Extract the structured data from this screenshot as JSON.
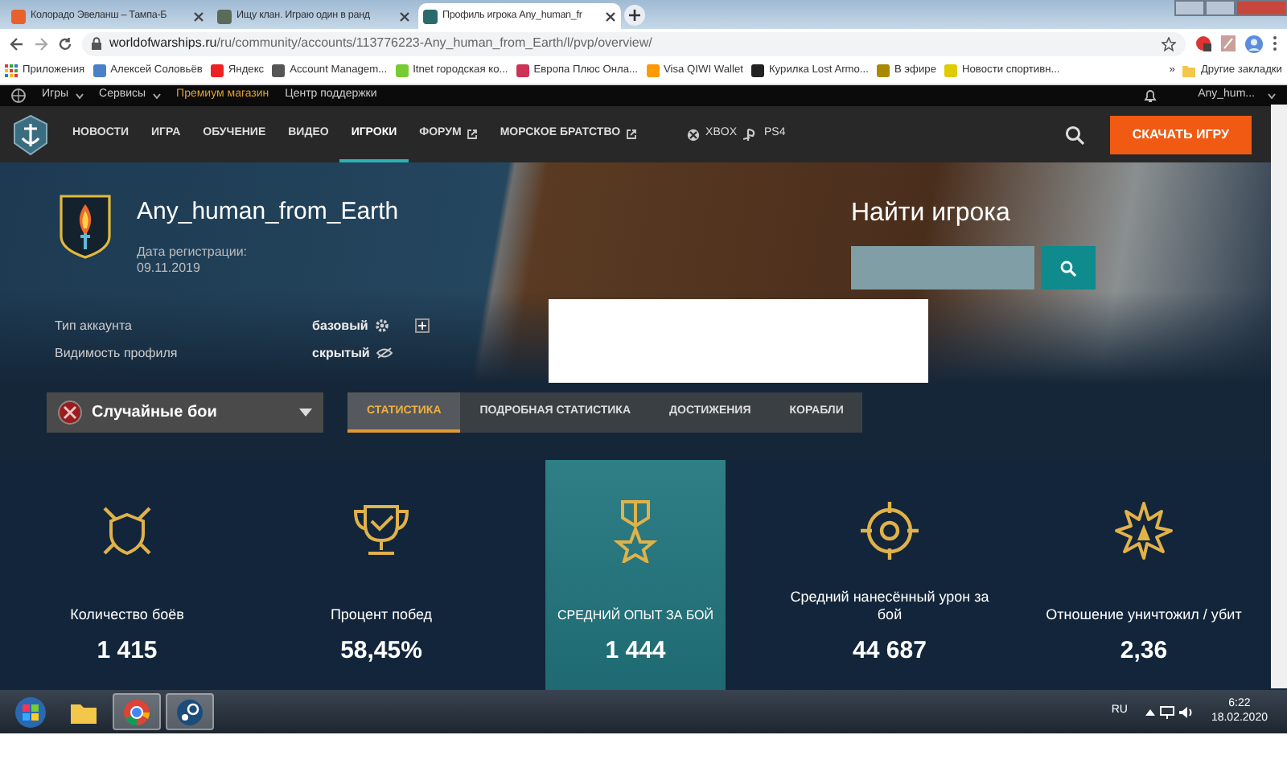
{
  "browser": {
    "tabs": [
      {
        "title": "Колорадо Эвеланш – Тампа-Б",
        "selected": false
      },
      {
        "title": "Ищу клан. Играю один в ранд",
        "selected": false
      },
      {
        "title": "Профиль игрока Any_human_fr",
        "selected": true
      }
    ],
    "address": "**worldofwarships.ru**/ru/community/accounts/113776223-Any_human_from_Earth/l/pvp/overview/",
    "bookmarks": [
      {
        "label": "Приложения"
      },
      {
        "label": "Алексей Соловьёв"
      },
      {
        "label": "Яндекс"
      },
      {
        "label": "Account Managem..."
      },
      {
        "label": "Itnet городская ко..."
      },
      {
        "label": "Европа Плюс Онла..."
      },
      {
        "label": "Visa QIWI Wallet"
      },
      {
        "label": "Курилка Lost Armo..."
      },
      {
        "label": "В эфире"
      },
      {
        "label": "Новости спортивн..."
      }
    ],
    "more": "»",
    "other_bookmarks": "Другие закладки"
  },
  "topbar": {
    "items": [
      {
        "label": "Игры",
        "dropdown": true,
        "highlight": false
      },
      {
        "label": "Сервисы",
        "dropdown": true,
        "highlight": false
      },
      {
        "label": "Премиум магазин",
        "dropdown": false,
        "highlight": true
      },
      {
        "label": "Центр поддержки",
        "dropdown": false,
        "highlight": false
      }
    ],
    "user": "Any_hum..."
  },
  "nav": {
    "items": [
      {
        "label": "НОВОСТИ",
        "selected": false,
        "external": false
      },
      {
        "label": "ИГРА",
        "selected": false,
        "external": false
      },
      {
        "label": "ОБУЧЕНИЕ",
        "selected": false,
        "external": false
      },
      {
        "label": "ВИДЕО",
        "selected": false,
        "external": false
      },
      {
        "label": "ИГРОКИ",
        "selected": true,
        "external": false
      },
      {
        "label": "ФОРУМ",
        "selected": false,
        "external": true
      },
      {
        "label": "МОРСКОЕ БРАТСТВО",
        "selected": false,
        "external": true
      }
    ],
    "platforms": [
      "XBOX",
      "PS4"
    ],
    "download": "СКАЧАТЬ ИГРУ"
  },
  "profile": {
    "name": "Any_human_from_Earth",
    "reg_label": "Дата регистрации:",
    "reg_date": "09.11.2019",
    "find_title": "Найти игрока",
    "rows": [
      {
        "label": "Тип аккаунта",
        "value": "базовый",
        "kind": "account"
      },
      {
        "label": "Видимость профиля",
        "value": "скрытый",
        "kind": "visibility"
      }
    ],
    "mode": "Случайные бои",
    "tabs": [
      {
        "label": "СТАТИСТИКА",
        "selected": true
      },
      {
        "label": "ПОДРОБНАЯ СТАТИСТИКА",
        "selected": false
      },
      {
        "label": "ДОСТИЖЕНИЯ",
        "selected": false
      },
      {
        "label": "КОРАБЛИ",
        "selected": false
      }
    ],
    "stats": [
      {
        "kind": "battles",
        "label": "Количество боёв",
        "value": "1 415",
        "selected": false
      },
      {
        "kind": "wins",
        "label": "Процент побед",
        "value": "58,45%",
        "selected": false
      },
      {
        "kind": "xp",
        "label": "СРЕДНИЙ ОПЫТ ЗА БОЙ",
        "value": "1 444",
        "selected": true
      },
      {
        "kind": "damage",
        "label": "Средний нанесённый урон за бой",
        "value": "44 687",
        "selected": false
      },
      {
        "kind": "kd",
        "label": "Отношение уничтожил / убит",
        "value": "2,36",
        "selected": false
      }
    ]
  },
  "taskbar": {
    "lang": "RU",
    "time": "6:22",
    "date": "18.02.2020"
  }
}
